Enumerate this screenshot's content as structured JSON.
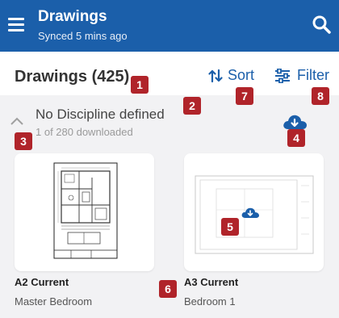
{
  "appbar": {
    "title": "Drawings",
    "subtitle": "Synced 5 mins ago",
    "bg_color": "#1b5faa",
    "menu_icon": "hamburger-menu-icon",
    "search_icon": "search-icon"
  },
  "subheader": {
    "count_label": "Drawings (425)",
    "sort_label": "Sort",
    "sort_icon": "sort-arrows-icon",
    "filter_label": "Filter",
    "filter_icon": "filter-sliders-icon"
  },
  "group": {
    "title": "No Discipline defined",
    "subtitle": "1 of 280 downloaded",
    "collapse_icon": "chevron-up-icon",
    "download_icon": "cloud-download-icon"
  },
  "drawings": [
    {
      "title": "A2 Current",
      "subtitle": "Master Bedroom",
      "downloaded": true
    },
    {
      "title": "A3 Current",
      "subtitle": "Bedroom 1",
      "downloaded": false
    }
  ],
  "badges": [
    "1",
    "2",
    "3",
    "4",
    "5",
    "6",
    "7",
    "8"
  ],
  "colors": {
    "accent": "#1b5faa",
    "badge": "#b0242a",
    "background": "#f2f2f4"
  }
}
